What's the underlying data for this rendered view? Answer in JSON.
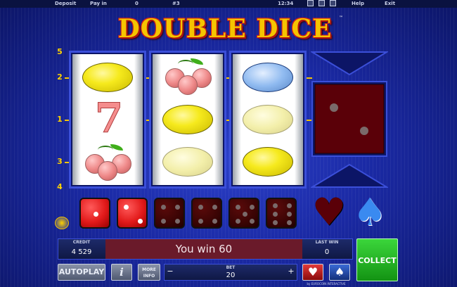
{
  "topbar": {
    "deposit": "Deposit",
    "pay_in": "Pay in",
    "pay_in_value": "0",
    "game_no": "#3",
    "clock": "12:34",
    "help": "Help",
    "exit": "Exit"
  },
  "logo": {
    "title": "DOUBLE DICE",
    "tm": "™"
  },
  "paylines": {
    "left_top": "5",
    "left_2": "2",
    "left_1": "1",
    "left_3": "3",
    "left_4": "4"
  },
  "reels": [
    {
      "symbols": [
        "lemon",
        "seven",
        "cherries"
      ]
    },
    {
      "symbols": [
        "cherries",
        "lemon",
        "lemon"
      ]
    },
    {
      "symbols": [
        "plum",
        "lemon",
        "lemon"
      ]
    }
  ],
  "gamble": {
    "die_pips": 2
  },
  "dice_row": {
    "values": [
      1,
      2,
      4,
      4,
      5,
      6
    ],
    "lit_count": 2
  },
  "suits": {
    "heart": "♥",
    "spade": "♠"
  },
  "panel": {
    "credit_label": "CREDIT",
    "credit_value": "4 529",
    "message": "You win 60",
    "last_win_label": "LAST WIN",
    "last_win_value": "0",
    "collect": "COLLECT",
    "autoplay": "AUTOPLAY",
    "info_icon": "i",
    "more_info_line1": "MORE",
    "more_info_line2": "INFO",
    "bet_label": "BET",
    "bet_value": "20",
    "bet_minus": "−",
    "bet_plus": "+",
    "footer": "by EUROCOIN INTERACTIVE"
  },
  "colors": {
    "accent_gold": "#f6c400",
    "collect_green": "#1fa51f",
    "message_bar": "#6a1a2a"
  }
}
